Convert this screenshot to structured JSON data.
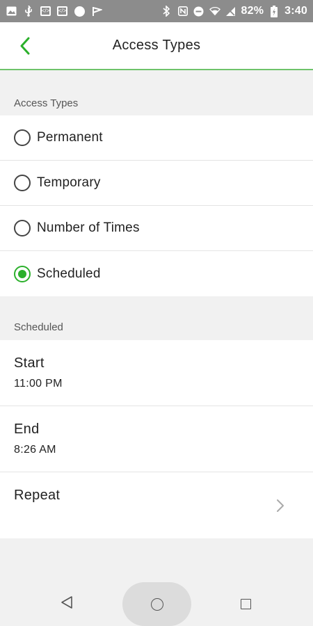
{
  "status_bar": {
    "battery_percent": "82%",
    "time": "3:40",
    "left_icons": [
      "image-icon",
      "usb-icon",
      "code-icon",
      "code-icon",
      "circle-icon",
      "flag-icon"
    ],
    "right_icons": [
      "bluetooth-icon",
      "nfc-icon",
      "do-not-disturb-icon",
      "wifi-icon",
      "no-signal-icon",
      "battery-charging-icon"
    ]
  },
  "header": {
    "title": "Access Types",
    "accent_color": "#2bb02b"
  },
  "access_types": {
    "section_label": "Access Types",
    "options": [
      {
        "label": "Permanent",
        "selected": false
      },
      {
        "label": "Temporary",
        "selected": false
      },
      {
        "label": "Number of Times",
        "selected": false
      },
      {
        "label": "Scheduled",
        "selected": true
      }
    ]
  },
  "scheduled": {
    "section_label": "Scheduled",
    "start": {
      "label": "Start",
      "value": "11:00 PM"
    },
    "end": {
      "label": "End",
      "value": "8:26 AM"
    },
    "repeat": {
      "label": "Repeat"
    }
  },
  "nav_bar": {
    "icons": [
      "nav-back-icon",
      "nav-home-icon",
      "nav-recents-icon"
    ]
  }
}
